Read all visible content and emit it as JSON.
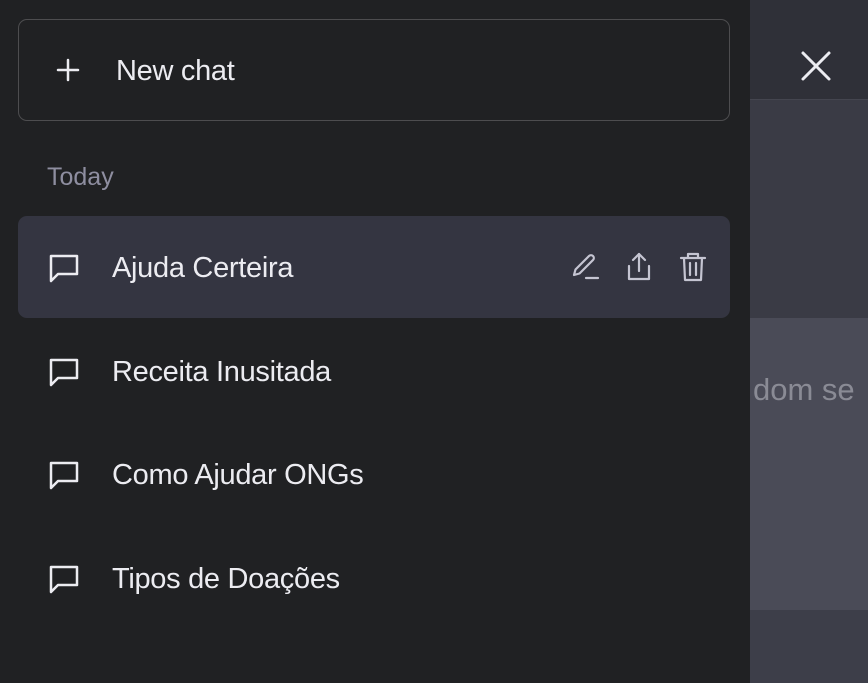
{
  "sidebar": {
    "new_chat_label": "New chat",
    "section_title": "Today",
    "chats": [
      {
        "title": "Ajuda Certeira",
        "active": true
      },
      {
        "title": "Receita Inusitada",
        "active": false
      },
      {
        "title": "Como Ajudar ONGs",
        "active": false
      },
      {
        "title": "Tipos de Doações",
        "active": false
      }
    ]
  },
  "background": {
    "partial_text": "dom se"
  },
  "icons": {
    "new_chat": "plus-icon",
    "chat_item": "message-icon",
    "edit": "pencil-icon",
    "share": "share-icon",
    "delete": "trash-icon",
    "close": "close-icon"
  },
  "colors": {
    "sidebar_bg": "#202123",
    "active_item_bg": "#343541",
    "text_primary": "#ececf1",
    "text_muted": "#8e8ea0",
    "border": "#4d4d4f"
  }
}
